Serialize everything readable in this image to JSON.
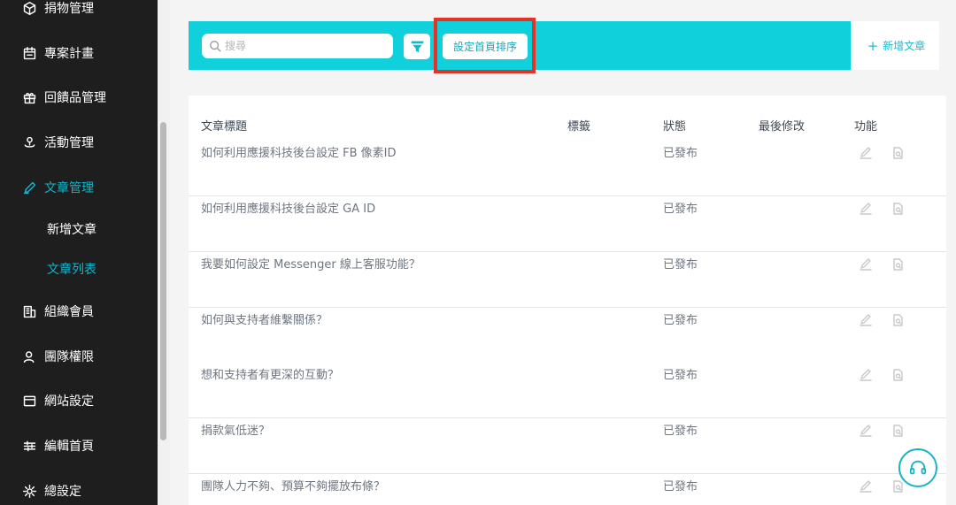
{
  "sidebar": {
    "items": [
      {
        "label": "捐物管理",
        "icon": "box-icon",
        "active": false
      },
      {
        "label": "專案計畫",
        "icon": "calendar-icon",
        "active": false
      },
      {
        "label": "回饋品管理",
        "icon": "gift-icon",
        "active": false
      },
      {
        "label": "活動管理",
        "icon": "event-icon",
        "active": false
      },
      {
        "label": "文章管理",
        "icon": "pen-icon",
        "active": true
      },
      {
        "label": "組織會員",
        "icon": "building-icon",
        "active": false
      },
      {
        "label": "團隊權限",
        "icon": "user-icon",
        "active": false
      },
      {
        "label": "網站設定",
        "icon": "browser-icon",
        "active": false
      },
      {
        "label": "編輯首頁",
        "icon": "sliders-icon",
        "active": false
      },
      {
        "label": "總設定",
        "icon": "gear-icon",
        "active": false
      }
    ],
    "subitems": [
      {
        "label": "新增文章",
        "active": false
      },
      {
        "label": "文章列表",
        "active": true
      }
    ]
  },
  "toolbar": {
    "search_placeholder": "搜尋",
    "sort_label": "設定首頁排序",
    "add_label": "新增文章",
    "add_plus": "+"
  },
  "table": {
    "headers": {
      "title": "文章標題",
      "tags": "標籤",
      "status": "狀態",
      "modified": "最後修改",
      "actions": "功能"
    },
    "rows": [
      {
        "title": "如何利用應援科技後台設定 FB 像素ID",
        "status": "已發布"
      },
      {
        "title": "如何利用應援科技後台設定 GA ID",
        "status": "已發布"
      },
      {
        "title": "我要如何設定 Messenger 線上客服功能？",
        "status": "已發布"
      },
      {
        "title": "如何與支持者維繫關係？",
        "status": "已發布"
      },
      {
        "title": "想和支持者有更深的互動？",
        "status": "已發布"
      },
      {
        "title": "捐款氣低迷？",
        "status": "已發布"
      },
      {
        "title": "團隊人力不夠、預算不夠擺放布條？",
        "status": "已發布"
      }
    ]
  },
  "colors": {
    "accent": "#12b5cb",
    "toolbar": "#0fd0db",
    "sidebar": "#1e1e1e",
    "highlight": "#e53224"
  }
}
